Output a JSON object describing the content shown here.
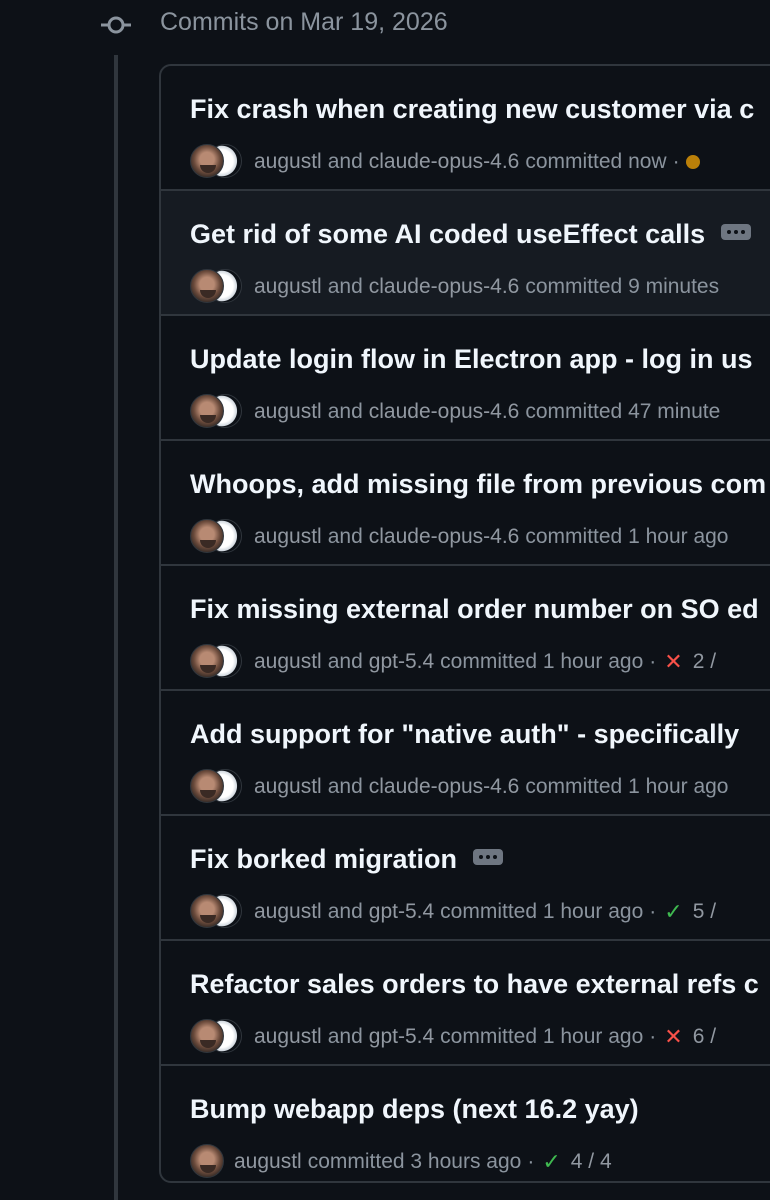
{
  "day_header": "Commits on Mar 19, 2026",
  "commits": [
    {
      "title": "Fix crash when creating new customer via c",
      "author": "augustl",
      "coauthor": "claude-opus-4.6",
      "time": "committed now",
      "checks": "",
      "has_ellipsis": false,
      "status": "pending"
    },
    {
      "title": "Get rid of some AI coded useEffect calls",
      "author": "augustl",
      "coauthor": "claude-opus-4.6",
      "time": "committed 9 minutes",
      "checks": "",
      "has_ellipsis": true,
      "status": "none"
    },
    {
      "title": "Update login flow in Electron app - log in us",
      "author": "augustl",
      "coauthor": "claude-opus-4.6",
      "time": "committed 47 minute",
      "checks": "",
      "has_ellipsis": false,
      "status": "none"
    },
    {
      "title": "Whoops, add missing file from previous com",
      "author": "augustl",
      "coauthor": "claude-opus-4.6",
      "time": "committed 1 hour ago",
      "checks": "",
      "has_ellipsis": false,
      "status": "none"
    },
    {
      "title": "Fix missing external order number on SO ed",
      "author": "augustl",
      "coauthor": "gpt-5.4",
      "time": "committed 1 hour ago",
      "checks": "2 /",
      "has_ellipsis": false,
      "status": "fail"
    },
    {
      "title": "Add support for \"native auth\" - specifically",
      "author": "augustl",
      "coauthor": "claude-opus-4.6",
      "time": "committed 1 hour ago",
      "checks": "",
      "has_ellipsis": false,
      "status": "none"
    },
    {
      "title": "Fix borked migration",
      "author": "augustl",
      "coauthor": "gpt-5.4",
      "time": "committed 1 hour ago",
      "checks": "5 /",
      "has_ellipsis": true,
      "status": "success"
    },
    {
      "title": "Refactor sales orders to have external refs c",
      "author": "augustl",
      "coauthor": "gpt-5.4",
      "time": "committed 1 hour ago",
      "checks": "6 /",
      "has_ellipsis": false,
      "status": "fail"
    },
    {
      "title": "Bump webapp deps (next 16.2 yay)",
      "author": "augustl",
      "coauthor": "",
      "time": "committed 3 hours ago",
      "checks": "4 / 4",
      "has_ellipsis": false,
      "status": "success"
    }
  ],
  "labels": {
    "and": "and",
    "separator": "·",
    "fail_glyph": "✕",
    "success_glyph": "✓"
  },
  "colors": {
    "background": "#0d1117",
    "border": "#30363d",
    "muted": "#8b949e",
    "success": "#3fb950",
    "fail": "#f85149",
    "pending": "#bb8009"
  }
}
